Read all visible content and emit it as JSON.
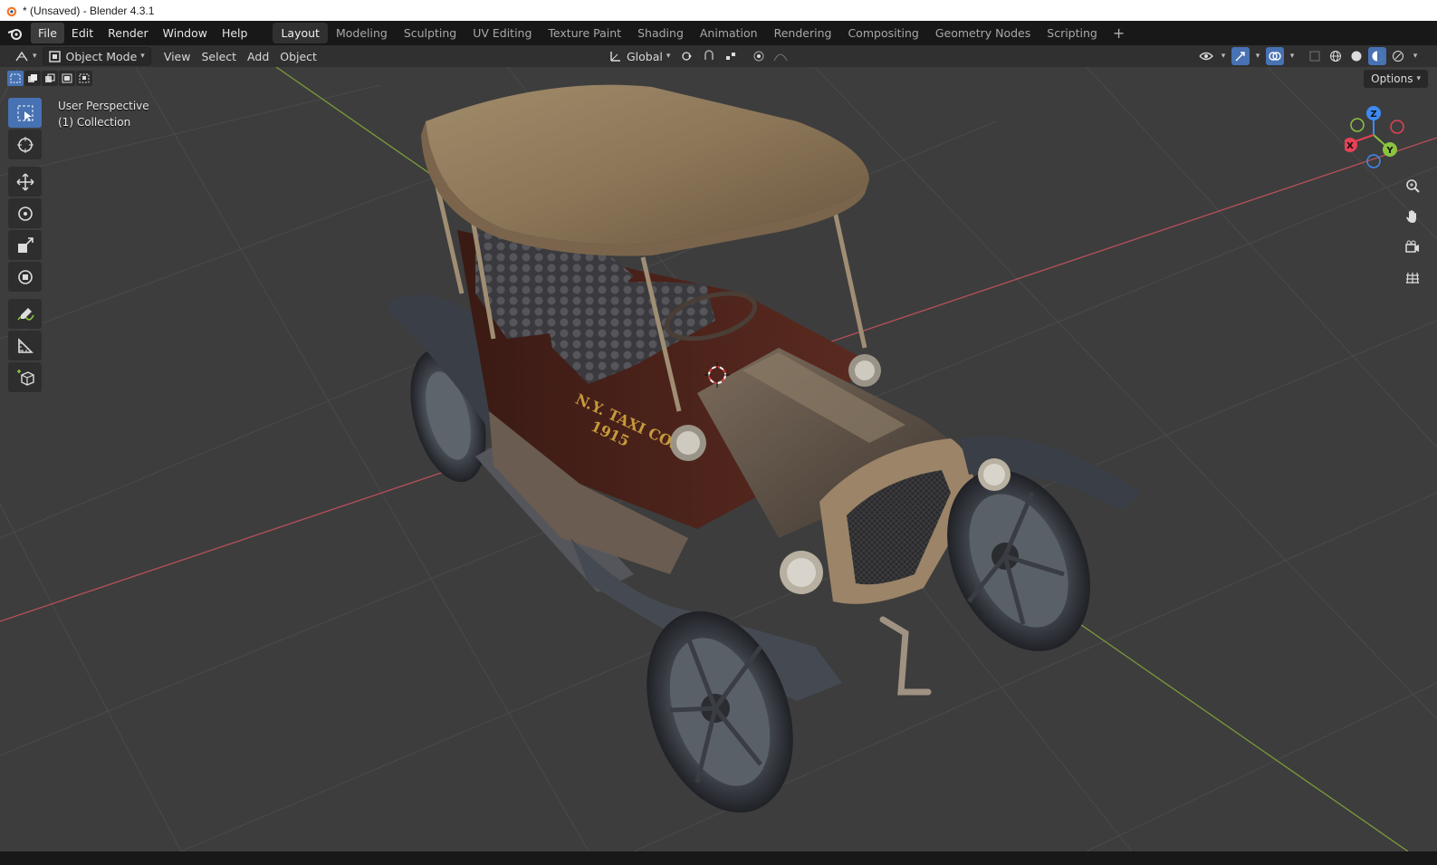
{
  "window": {
    "title": "* (Unsaved) - Blender 4.3.1"
  },
  "menu": [
    "File",
    "Edit",
    "Render",
    "Window",
    "Help"
  ],
  "workspaces": [
    "Layout",
    "Modeling",
    "Sculpting",
    "UV Editing",
    "Texture Paint",
    "Shading",
    "Animation",
    "Rendering",
    "Compositing",
    "Geometry Nodes",
    "Scripting"
  ],
  "header": {
    "mode": "Object Mode",
    "view_menu": [
      "View",
      "Select",
      "Add",
      "Object"
    ],
    "orientation": "Global",
    "options": "Options"
  },
  "viewport": {
    "perspective": "User Perspective",
    "collection": "(1) Collection",
    "car_text_line1": "N.Y. TAXI CO.",
    "car_text_line2": "1915"
  },
  "gizmo": {
    "x": "X",
    "y": "Y",
    "z": "Z"
  },
  "colors": {
    "accent": "#4772b3",
    "axis_x": "#e64155",
    "axis_y": "#8bc43f",
    "axis_z": "#3d8bf2",
    "x_line": "#b8505a",
    "y_line": "#7a9a3a"
  },
  "icons": [
    "blender-logo-icon",
    "editor-type-icon",
    "object-mode-icon",
    "select-box-icon",
    "cursor-icon",
    "move-icon",
    "rotate-icon",
    "scale-icon",
    "transform-icon",
    "annotate-icon",
    "measure-icon",
    "add-cube-icon",
    "zoom-icon",
    "hand-pan-icon",
    "camera-view-icon",
    "ortho-grid-icon"
  ]
}
